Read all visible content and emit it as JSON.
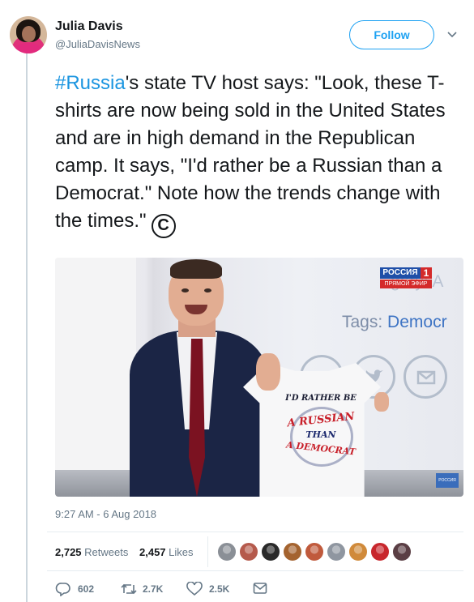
{
  "author": {
    "name": "Julia Davis",
    "handle": "@JuliaDavisNews"
  },
  "follow_label": "Follow",
  "tweet": {
    "hashtag": "#Russia",
    "text": "'s state TV host says: \"Look, these T-shirts are now being sold in the United States and are in high demand in the Republican camp. It says, \"I'd rather be a Russian than a Democrat.\" Note how the trends change with the times.\"",
    "copyright_symbol": "C"
  },
  "media": {
    "channel_logo_top": "РОССИЯ",
    "channel_logo_number": "1",
    "channel_logo_bottom": "ПРЯМОЙ ЭФИР",
    "screen_text_category": "gory: A",
    "screen_text_tags_label": "Tags:",
    "screen_text_tags_value": "Democr",
    "tshirt_line1": "I'D RATHER BE",
    "tshirt_line2": "A RUSSIAN",
    "tshirt_line3": "THAN",
    "tshirt_line4": "A DEMOCRAT",
    "corner_badge": "РОССИЯ"
  },
  "timestamp": "9:27 AM - 6 Aug 2018",
  "stats": {
    "retweets_count": "2,725",
    "retweets_label": "Retweets",
    "likes_count": "2,457",
    "likes_label": "Likes"
  },
  "liker_avatar_colors": [
    "#8a8f96",
    "#b55a4c",
    "#2a2a2a",
    "#a4632f",
    "#c05a3c",
    "#8f96a0",
    "#d08a3a",
    "#c8272d",
    "#5a3e44"
  ],
  "actions": {
    "reply_count": "602",
    "retweet_count": "2.7K",
    "like_count": "2.5K"
  },
  "colors": {
    "accent": "#1da1f2",
    "hashtag": "#1b95e0",
    "secondary_text": "#657786"
  }
}
